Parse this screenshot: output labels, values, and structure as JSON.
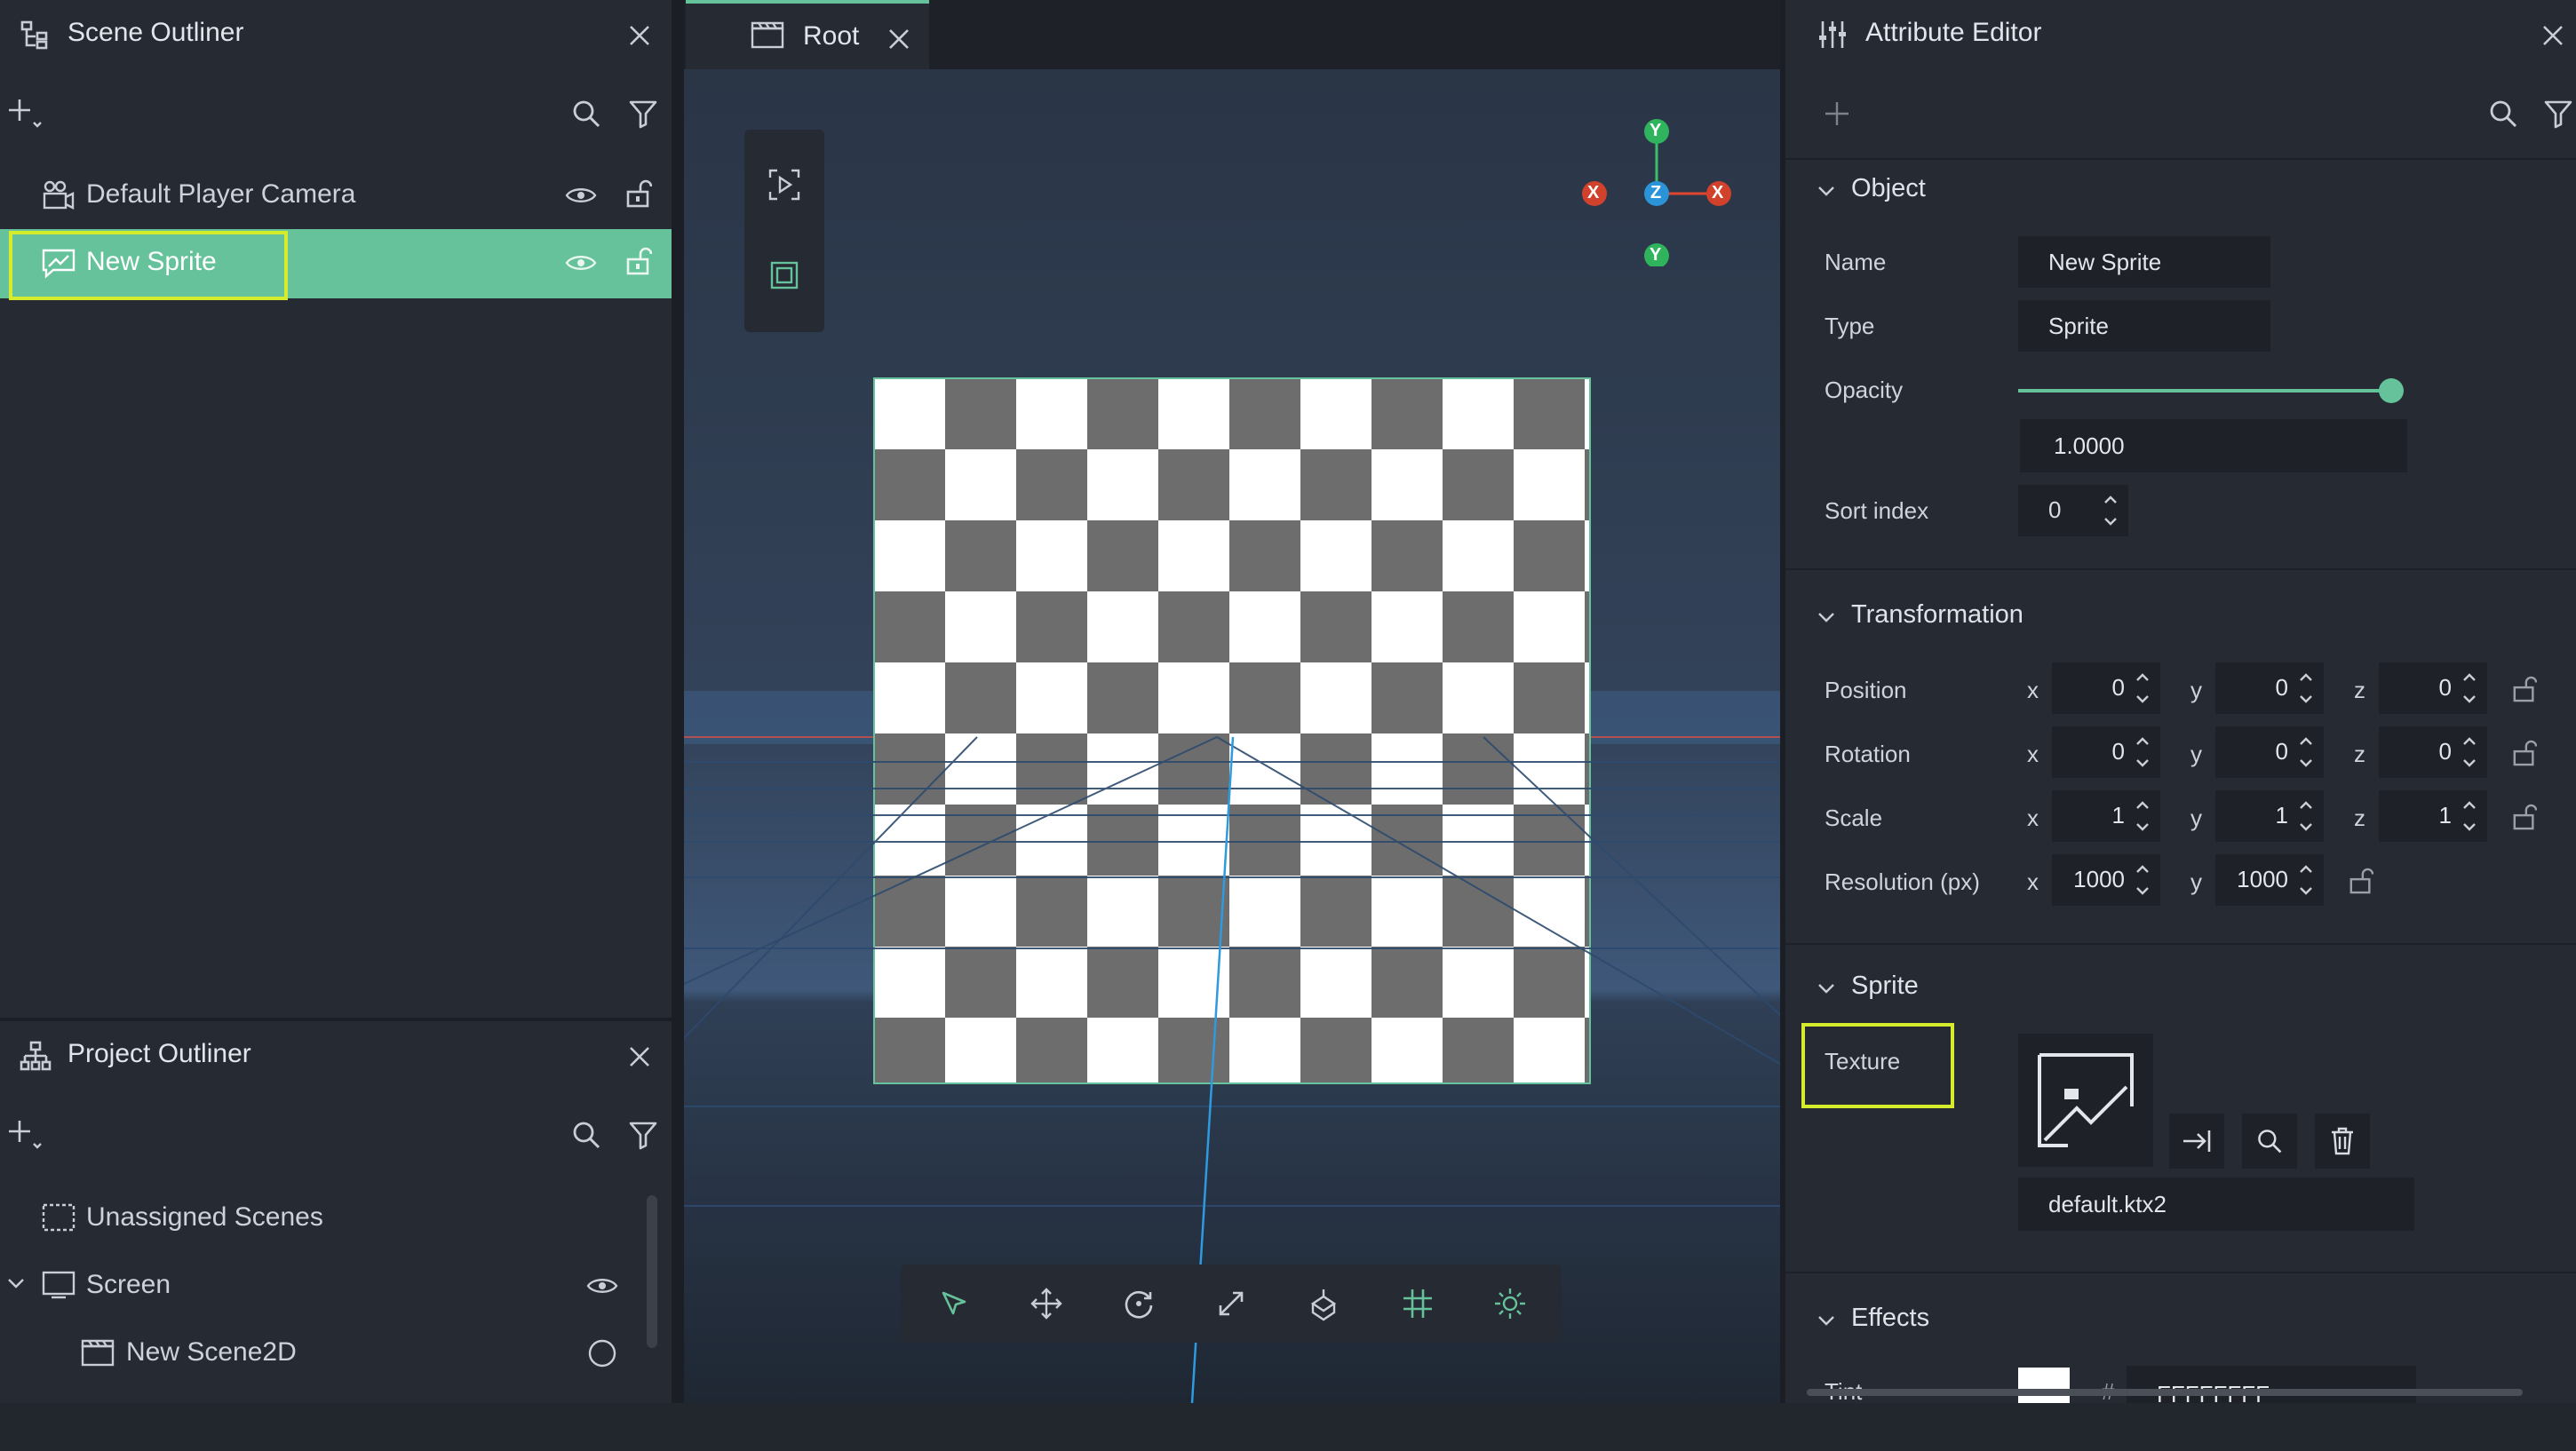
{
  "scene_outliner": {
    "title": "Scene Outliner",
    "items": [
      {
        "label": "Default Player Camera"
      },
      {
        "label": "New Sprite"
      }
    ]
  },
  "project_outliner": {
    "title": "Project Outliner",
    "items": [
      {
        "label": "Unassigned Scenes"
      },
      {
        "label": "Screen"
      },
      {
        "label": "New Scene2D"
      }
    ]
  },
  "viewport": {
    "tab_label": "Root",
    "gizmo": {
      "y_pos": "Y",
      "x_neg": "X",
      "z": "Z",
      "x_pos": "X",
      "y_neg": "Y"
    }
  },
  "attribute_editor": {
    "title": "Attribute Editor",
    "object": {
      "header": "Object",
      "name_label": "Name",
      "name_value": "New Sprite",
      "type_label": "Type",
      "type_value": "Sprite",
      "opacity_label": "Opacity",
      "opacity_value": "1.0000",
      "opacity_fraction": 1.0,
      "sort_label": "Sort index",
      "sort_value": "0"
    },
    "transformation": {
      "header": "Transformation",
      "position": {
        "label": "Position",
        "x": "0",
        "y": "0",
        "z": "0"
      },
      "rotation": {
        "label": "Rotation",
        "x": "0",
        "y": "0",
        "z": "0"
      },
      "scale": {
        "label": "Scale",
        "x": "1",
        "y": "1",
        "z": "1"
      },
      "resolution": {
        "label": "Resolution (px)",
        "x": "1000",
        "y": "1000"
      },
      "axis_x": "x",
      "axis_y": "y",
      "axis_z": "z"
    },
    "sprite": {
      "header": "Sprite",
      "texture_label": "Texture",
      "texture_file": "default.ktx2"
    },
    "effects": {
      "header": "Effects",
      "tint_label": "Tint",
      "tint_hash": "#",
      "tint_value": "FFFFFFFF"
    }
  },
  "colors": {
    "accent": "#66c29a",
    "highlight": "#d4ec2c",
    "panel": "#262a32",
    "field": "#1e2128"
  }
}
